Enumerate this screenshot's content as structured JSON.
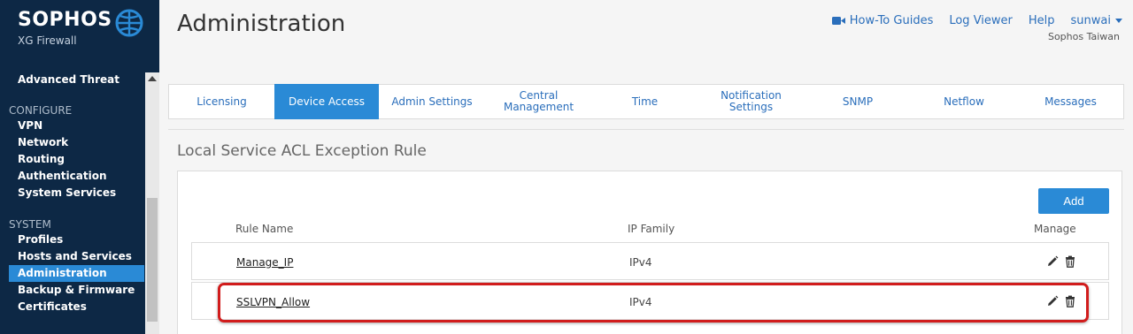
{
  "brand": {
    "name": "SOPHOS",
    "subtitle": "XG Firewall"
  },
  "sidebar": {
    "items": [
      {
        "type": "item",
        "label": "Advanced Threat"
      },
      {
        "type": "section",
        "label": "CONFIGURE"
      },
      {
        "type": "item",
        "label": "VPN"
      },
      {
        "type": "item",
        "label": "Network"
      },
      {
        "type": "item",
        "label": "Routing"
      },
      {
        "type": "item",
        "label": "Authentication"
      },
      {
        "type": "item",
        "label": "System Services"
      },
      {
        "type": "section",
        "label": "SYSTEM"
      },
      {
        "type": "item",
        "label": "Profiles"
      },
      {
        "type": "item",
        "label": "Hosts and Services"
      },
      {
        "type": "item",
        "label": "Administration",
        "active": true
      },
      {
        "type": "item",
        "label": "Backup & Firmware"
      },
      {
        "type": "item",
        "label": "Certificates"
      }
    ]
  },
  "header": {
    "title": "Administration",
    "howto": "How-To Guides",
    "logviewer": "Log Viewer",
    "help": "Help",
    "user": "sunwai",
    "org": "Sophos Taiwan"
  },
  "tabs": [
    {
      "label": "Licensing"
    },
    {
      "label": "Device Access",
      "active": true
    },
    {
      "label": "Admin Settings"
    },
    {
      "label": "Central\nManagement"
    },
    {
      "label": "Time"
    },
    {
      "label": "Notification\nSettings"
    },
    {
      "label": "SNMP"
    },
    {
      "label": "Netflow"
    },
    {
      "label": "Messages"
    }
  ],
  "section": {
    "title": "Local Service ACL Exception Rule",
    "add_label": "Add",
    "columns": {
      "name": "Rule Name",
      "family": "IP Family",
      "manage": "Manage"
    },
    "rows": [
      {
        "name": "Manage_IP",
        "family": "IPv4"
      },
      {
        "name": "SSLVPN_Allow",
        "family": "IPv4",
        "highlighted": true
      }
    ]
  },
  "colors": {
    "accent": "#2a8ad6",
    "sidebar": "#0d2845",
    "highlight": "#d11c1c",
    "link": "#2a6ebb"
  }
}
